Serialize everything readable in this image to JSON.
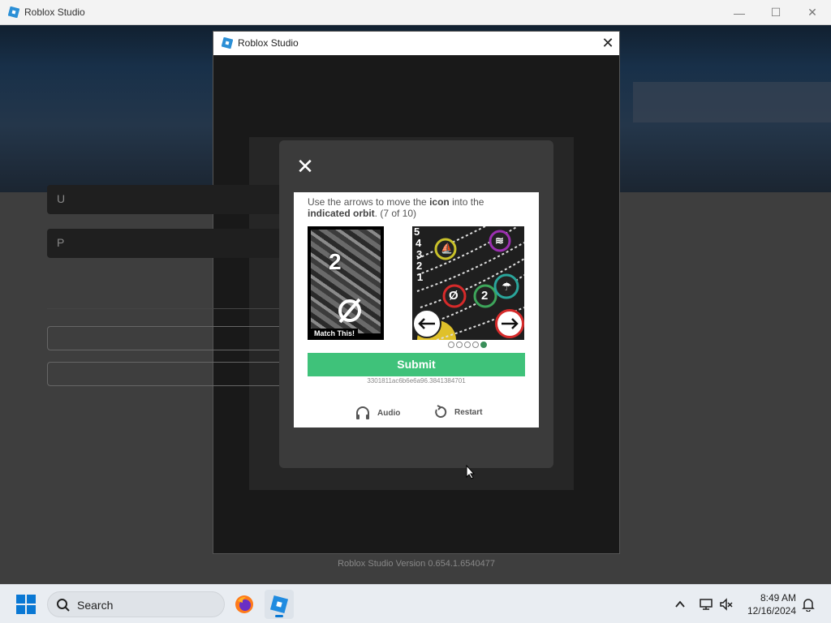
{
  "outer_window": {
    "title": "Roblox Studio",
    "controls": {
      "minimize": "—",
      "maximize": "☐",
      "close": "✕"
    }
  },
  "dialog": {
    "title": "Roblox Studio",
    "close_glyph": "✕",
    "version_text": "Roblox Studio Version 0.654.1.6540477",
    "background_field_letters": [
      "U",
      "P"
    ]
  },
  "captcha": {
    "close_glyph": "✕",
    "instruction_prefix": "Use the arrows to move the ",
    "instruction_icon": "icon",
    "instruction_mid": " into the ",
    "instruction_orbit": "indicated orbit",
    "instruction_suffix": ". (7 of 10)",
    "match_card": {
      "number": "2",
      "symbol": "Ø",
      "caption": "Match This!"
    },
    "orbit_numbers": [
      "5",
      "4",
      "3",
      "2",
      "1"
    ],
    "orbit_icons": [
      {
        "glyph": "⛵",
        "ring_color": "#c9c12a"
      },
      {
        "glyph": "≋",
        "ring_color": "#9b2fb0"
      },
      {
        "glyph": "Ø",
        "ring_color": "#d62a2a"
      },
      {
        "glyph": "2",
        "ring_color": "#3da55a"
      },
      {
        "glyph": "☂",
        "ring_color": "#2aa59b"
      }
    ],
    "progress": {
      "total": 5,
      "active_index": 4
    },
    "submit_label": "Submit",
    "session_id": "3301811ac6b6e6a96.3841384701",
    "audio_label": "Audio",
    "restart_label": "Restart"
  },
  "taskbar": {
    "search_placeholder": "Search",
    "time": "8:49 AM",
    "date": "12/16/2024"
  },
  "colors": {
    "submit_green": "#3fc27a",
    "modal_bg": "#3b3b3b",
    "accent_blue": "#0a78d4"
  }
}
